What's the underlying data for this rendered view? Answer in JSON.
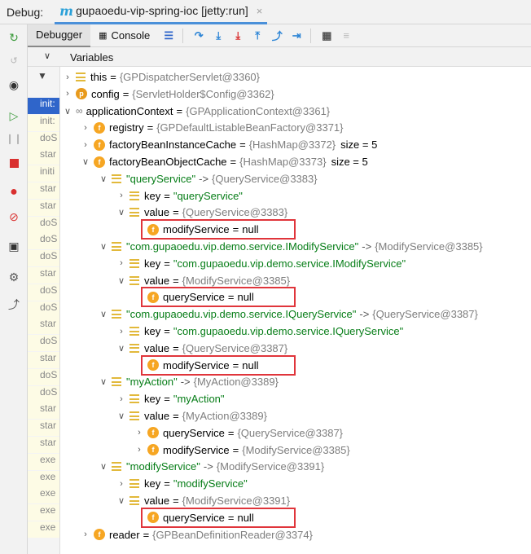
{
  "title_bar": {
    "debug_label": "Debug:",
    "run_config_icon": "m-module-icon",
    "run_config_name": "gupaoedu-vip-spring-ioc [jetty:run]",
    "close_glyph": "×"
  },
  "tabs": [
    {
      "label": "Debugger",
      "active": true
    },
    {
      "label": "Console",
      "icon": "console-icon",
      "active": false
    }
  ],
  "toolbar_icons": [
    "menu-icon",
    "show-execution-point-icon",
    "step-over-icon",
    "step-into-icon",
    "force-step-into-icon",
    "step-out-icon",
    "drop-frame-icon",
    "run-to-cursor-icon",
    "evaluate-expression-icon",
    "trace-icon"
  ],
  "left_toolbar_icons": [
    "rerun-icon",
    "restart-icon",
    "view-breakpoints-icon",
    "resume-icon",
    "pause-icon",
    "stop-icon",
    "breakpoints-icon",
    "mute-breakpoints-icon",
    "camera-icon",
    "settings-icon",
    "pin-icon"
  ],
  "variables_header": "Variables",
  "frames": [
    "init:",
    "init:",
    "doS",
    "star",
    "initi",
    "star",
    "star",
    "doS",
    "doS",
    "doS",
    "star",
    "doS",
    "doS",
    "star",
    "doS",
    "star",
    "doS",
    "doS",
    "star",
    "star",
    "star",
    "exe",
    "exe",
    "exe",
    "exe",
    "exe"
  ],
  "selected_frame_index": 0,
  "tree": [
    {
      "depth": 0,
      "arrow": ">",
      "icon": "lines",
      "name": "this",
      "value": "{GPDispatcherServlet@3360}"
    },
    {
      "depth": 0,
      "arrow": ">",
      "icon": "p",
      "name": "config",
      "value": "{ServletHolder$Config@3362}"
    },
    {
      "depth": 0,
      "arrow": "v",
      "icon": "oo",
      "name": "applicationContext",
      "value": "{GPApplicationContext@3361}"
    },
    {
      "depth": 1,
      "arrow": ">",
      "icon": "f",
      "name": "registry",
      "value": "{GPDefaultListableBeanFactory@3371}"
    },
    {
      "depth": 1,
      "arrow": ">",
      "icon": "f",
      "name": "factoryBeanInstanceCache",
      "value": "{HashMap@3372}",
      "extra": "size = 5"
    },
    {
      "depth": 1,
      "arrow": "v",
      "icon": "f",
      "name": "factoryBeanObjectCache",
      "value": "{HashMap@3373}",
      "extra": "size = 5"
    },
    {
      "depth": 2,
      "arrow": "v",
      "icon": "lines",
      "key": "\"queryService\"",
      "value": "{QueryService@3383}"
    },
    {
      "depth": 3,
      "arrow": ">",
      "icon": "lines",
      "name": "key",
      "str": "\"queryService\""
    },
    {
      "depth": 3,
      "arrow": "v",
      "icon": "lines",
      "name": "value",
      "value": "{QueryService@3383}"
    },
    {
      "depth": 4,
      "arrow": "",
      "icon": "f",
      "name": "modifyService",
      "plain": "null",
      "highlight": true
    },
    {
      "depth": 2,
      "arrow": "v",
      "icon": "lines",
      "key": "\"com.gupaoedu.vip.demo.service.IModifyService\"",
      "value": "{ModifyService@3385}"
    },
    {
      "depth": 3,
      "arrow": ">",
      "icon": "lines",
      "name": "key",
      "str": "\"com.gupaoedu.vip.demo.service.IModifyService\""
    },
    {
      "depth": 3,
      "arrow": "v",
      "icon": "lines",
      "name": "value",
      "value": "{ModifyService@3385}"
    },
    {
      "depth": 4,
      "arrow": "",
      "icon": "f",
      "name": "queryService",
      "plain": "null",
      "highlight": true
    },
    {
      "depth": 2,
      "arrow": "v",
      "icon": "lines",
      "key": "\"com.gupaoedu.vip.demo.service.IQueryService\"",
      "value": "{QueryService@3387}"
    },
    {
      "depth": 3,
      "arrow": ">",
      "icon": "lines",
      "name": "key",
      "str": "\"com.gupaoedu.vip.demo.service.IQueryService\""
    },
    {
      "depth": 3,
      "arrow": "v",
      "icon": "lines",
      "name": "value",
      "value": "{QueryService@3387}"
    },
    {
      "depth": 4,
      "arrow": "",
      "icon": "f",
      "name": "modifyService",
      "plain": "null",
      "highlight": true
    },
    {
      "depth": 2,
      "arrow": "v",
      "icon": "lines",
      "key": "\"myAction\"",
      "value": "{MyAction@3389}"
    },
    {
      "depth": 3,
      "arrow": ">",
      "icon": "lines",
      "name": "key",
      "str": "\"myAction\""
    },
    {
      "depth": 3,
      "arrow": "v",
      "icon": "lines",
      "name": "value",
      "value": "{MyAction@3389}"
    },
    {
      "depth": 4,
      "arrow": ">",
      "icon": "f",
      "name": "queryService",
      "value": "{QueryService@3387}"
    },
    {
      "depth": 4,
      "arrow": ">",
      "icon": "f",
      "name": "modifyService",
      "value": "{ModifyService@3385}"
    },
    {
      "depth": 2,
      "arrow": "v",
      "icon": "lines",
      "key": "\"modifyService\"",
      "value": "{ModifyService@3391}"
    },
    {
      "depth": 3,
      "arrow": ">",
      "icon": "lines",
      "name": "key",
      "str": "\"modifyService\""
    },
    {
      "depth": 3,
      "arrow": "v",
      "icon": "lines",
      "name": "value",
      "value": "{ModifyService@3391}"
    },
    {
      "depth": 4,
      "arrow": "",
      "icon": "f",
      "name": "queryService",
      "plain": "null",
      "highlight": true
    },
    {
      "depth": 1,
      "arrow": ">",
      "icon": "f",
      "name": "reader",
      "value": "{GPBeanDefinitionReader@3374}"
    }
  ],
  "colors": {
    "selected_frame": "#2f65ca",
    "highlight_box": "#e0353b",
    "string_value": "#067d17",
    "field_badge": "#f6a623",
    "reference_value": "#7e7e7e"
  }
}
